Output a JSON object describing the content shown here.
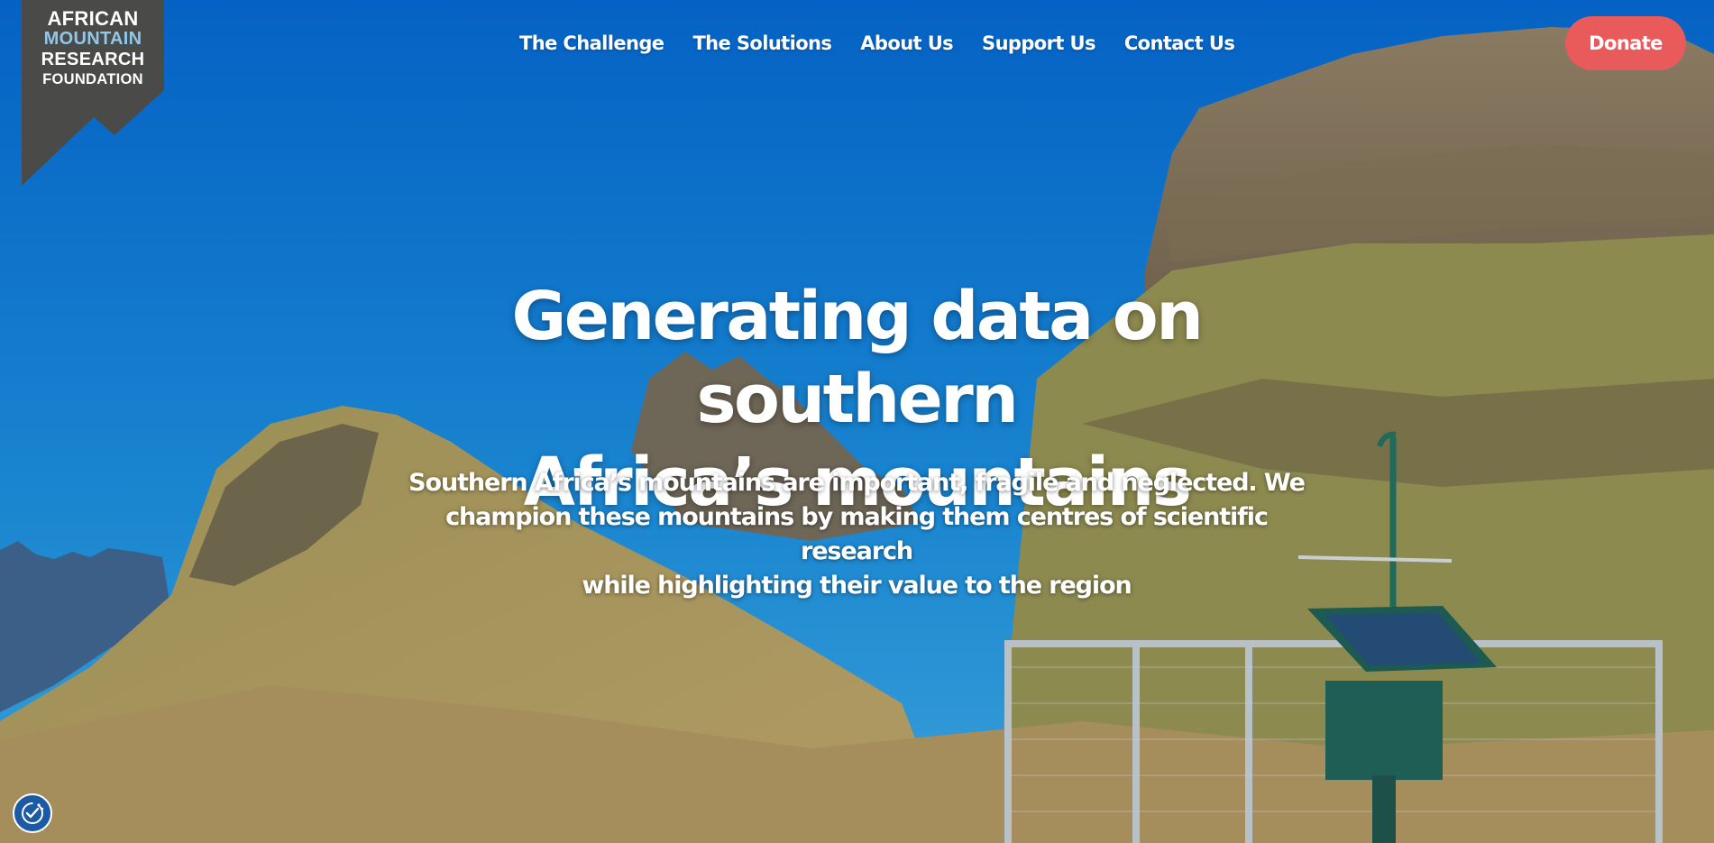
{
  "logo": {
    "line1": "AFRICAN",
    "line2": "MOUNTAIN",
    "line3": "RESEARCH",
    "line4": "FOUNDATION",
    "colors": {
      "ribbon": "#4a4a48",
      "accent": "#8ec8ea"
    }
  },
  "nav": {
    "items": [
      {
        "label": "The Challenge"
      },
      {
        "label": "The Solutions"
      },
      {
        "label": "About Us"
      },
      {
        "label": "Support Us"
      },
      {
        "label": "Contact Us"
      }
    ],
    "donate_label": "Donate",
    "donate_color": "#e95a5a"
  },
  "hero": {
    "title_line1": "Generating data on southern",
    "title_line2": "Africa’s mountains",
    "sub_line1": "Southern Africa’s mountains are important, fragile and neglected. We",
    "sub_line2": "champion these mountains by making them centres of scientific research",
    "sub_line3": "while highlighting their value to the region",
    "background": "mountain-landscape-photo"
  },
  "cookie_widget": {
    "icon": "cookie-settings-icon"
  }
}
